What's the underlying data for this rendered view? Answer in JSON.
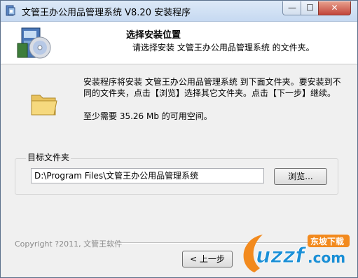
{
  "window": {
    "title": "文管王办公用品管理系统 V8.20 安装程序",
    "controls": {
      "minimize": "—",
      "maximize": "☐",
      "close": "✕"
    }
  },
  "header": {
    "title": "选择安装位置",
    "subtitle": "请选择安装 文管王办公用品管理系统 的文件夹。"
  },
  "body": {
    "description": "安装程序将安装 文管王办公用品管理系统 到下面文件夹。要安装到不同的文件夹，点击【浏览】选择其它文件夹。点击【下一步】继续。",
    "space_required": "至少需要 35.26 Mb 的可用空间。"
  },
  "destination": {
    "group_label": "目标文件夹",
    "path": "D:\\Program Files\\文管王办公用品管理系统",
    "browse_label": "浏览..."
  },
  "footer": {
    "copyright": "Copyright ?2011, 文管王软件",
    "back_label": "< 上一步"
  },
  "watermark": {
    "text": "uzzf.com",
    "badge": "东坡下载"
  },
  "colors": {
    "titlebar": "#c6d9f1",
    "close": "#c2453a",
    "watermark_orange": "#f28a1e",
    "watermark_blue": "#1a8fd6"
  }
}
